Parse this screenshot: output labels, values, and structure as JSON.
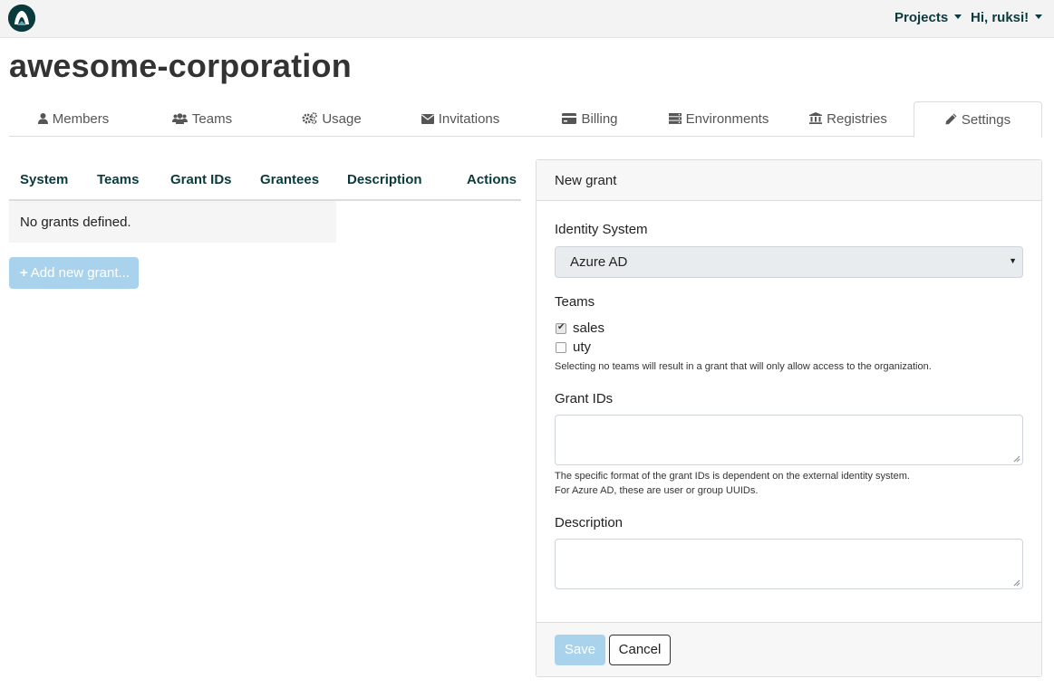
{
  "navbar": {
    "projects_label": "Projects",
    "user_label": "Hi, ruksi!"
  },
  "page": {
    "title": "awesome-corporation"
  },
  "tabs": [
    {
      "label": "Members",
      "icon": "user-icon"
    },
    {
      "label": "Teams",
      "icon": "users-icon"
    },
    {
      "label": "Usage",
      "icon": "cogs-icon"
    },
    {
      "label": "Invitations",
      "icon": "envelope-icon"
    },
    {
      "label": "Billing",
      "icon": "credit-card-icon"
    },
    {
      "label": "Environments",
      "icon": "server-icon"
    },
    {
      "label": "Registries",
      "icon": "bank-icon"
    },
    {
      "label": "Settings",
      "icon": "pencil-icon",
      "active": true
    }
  ],
  "grants_table": {
    "columns": [
      "System",
      "Teams",
      "Grant IDs",
      "Grantees",
      "Description",
      "Actions"
    ],
    "empty_message": "No grants defined.",
    "add_button": "Add new grant..."
  },
  "new_grant": {
    "header": "New grant",
    "identity_system_label": "Identity System",
    "identity_system_value": "Azure AD",
    "teams_label": "Teams",
    "teams": [
      {
        "name": "sales",
        "checked": true
      },
      {
        "name": "uty",
        "checked": false
      }
    ],
    "teams_help": "Selecting no teams will result in a grant that will only allow access to the organization.",
    "grant_ids_label": "Grant IDs",
    "grant_ids_value": "",
    "grant_ids_help_1": "The specific format of the grant IDs is dependent on the external identity system.",
    "grant_ids_help_2": "For Azure AD, these are user or group UUIDs.",
    "description_label": "Description",
    "description_value": "",
    "save_button": "Save",
    "cancel_button": "Cancel"
  },
  "colors": {
    "brand_dark": "#0b3a3d",
    "disabled_primary": "#a9d3ec",
    "input_disabled_bg": "#e9ecef"
  }
}
